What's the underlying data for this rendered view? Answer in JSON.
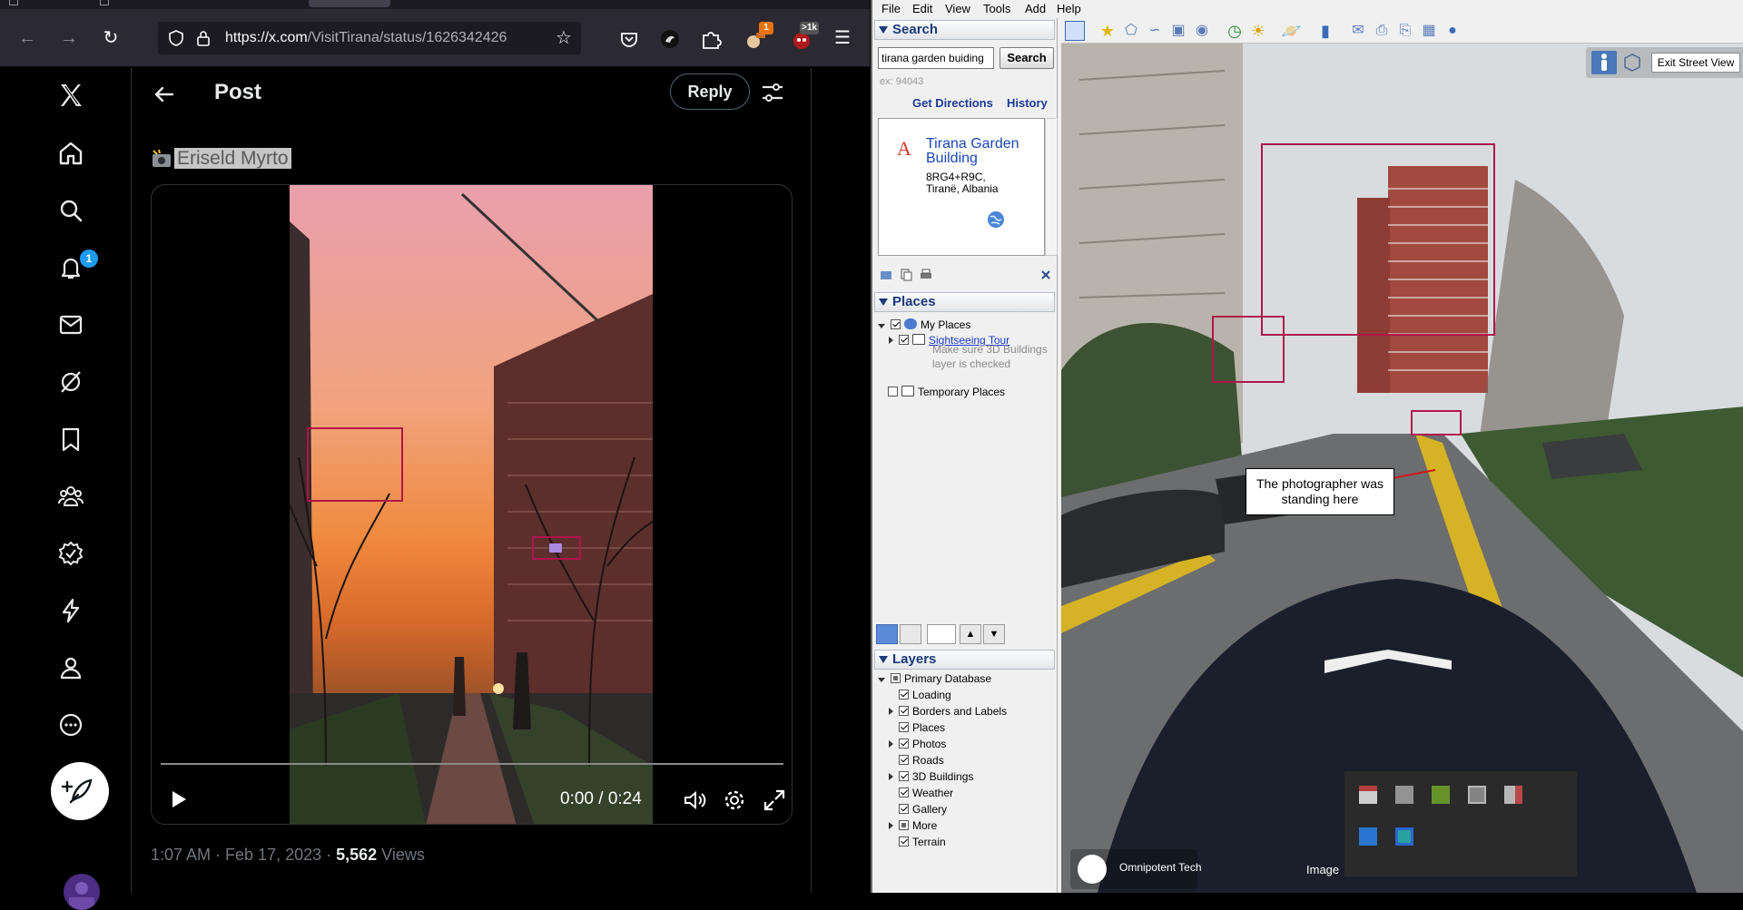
{
  "browser": {
    "url_domain": "https://x.com",
    "url_rest": "/VisitTirana/status/1626342426",
    "extensions": [
      {
        "name": "pocket-icon"
      },
      {
        "name": "ublock-like-icon"
      },
      {
        "name": "puzzle-icon"
      },
      {
        "name": "profile-ext-icon",
        "badge": "1",
        "badge_color": "#e8740f"
      },
      {
        "name": "red-ext-icon",
        "badge": ">1k",
        "badge_color": "#555555"
      }
    ]
  },
  "x": {
    "notification_count": "1",
    "header_title": "Post",
    "reply_label": "Reply",
    "author_name": "Eriseld Myrto",
    "video_time": "0:00 / 0:24",
    "timestamp": "1:07 AM · Feb 17, 2023 · ",
    "views_count": "5,562",
    "views_label": " Views"
  },
  "google_earth": {
    "menu": [
      "File",
      "Edit",
      "View",
      "Tools",
      "Add",
      "Help"
    ],
    "search_header": "Search",
    "search_value": "tirana garden buiding",
    "search_button": "Search",
    "search_hint": "ex: 94043",
    "get_directions": "Get Directions",
    "history": "History",
    "result": {
      "letter": "A",
      "title": "Tirana Garden Building",
      "address_line1": "8RG4+R9C,",
      "address_line2": "Tiranë, Albania"
    },
    "places_header": "Places",
    "places": {
      "my_places": "My Places",
      "sightseeing": "Sightseeing Tour",
      "note": "Make sure 3D Buildings layer is checked",
      "temporary": "Temporary Places"
    },
    "layers_header": "Layers",
    "layers": [
      {
        "label": "Primary Database",
        "checked": "partial",
        "expand": "open",
        "indent": 0
      },
      {
        "label": "Loading",
        "checked": "on",
        "expand": "none",
        "indent": 1
      },
      {
        "label": "Borders and Labels",
        "checked": "on",
        "expand": "closed",
        "indent": 1
      },
      {
        "label": "Places",
        "checked": "on",
        "expand": "none",
        "indent": 1
      },
      {
        "label": "Photos",
        "checked": "on",
        "expand": "closed",
        "indent": 1
      },
      {
        "label": "Roads",
        "checked": "on",
        "expand": "none",
        "indent": 1
      },
      {
        "label": "3D Buildings",
        "checked": "on",
        "expand": "closed",
        "indent": 1
      },
      {
        "label": "Weather",
        "checked": "on",
        "expand": "none",
        "indent": 1
      },
      {
        "label": "Gallery",
        "checked": "on",
        "expand": "none",
        "indent": 1
      },
      {
        "label": "More",
        "checked": "partial",
        "expand": "closed",
        "indent": 1
      },
      {
        "label": "Terrain",
        "checked": "on",
        "expand": "none",
        "indent": 1
      }
    ],
    "exit_street_view": "Exit Street View",
    "annotation": "The photographer was standing here",
    "logo_text": "Omnipotent Tech",
    "imagery_credit": "Image",
    "highlight_color": "#b0154a"
  }
}
